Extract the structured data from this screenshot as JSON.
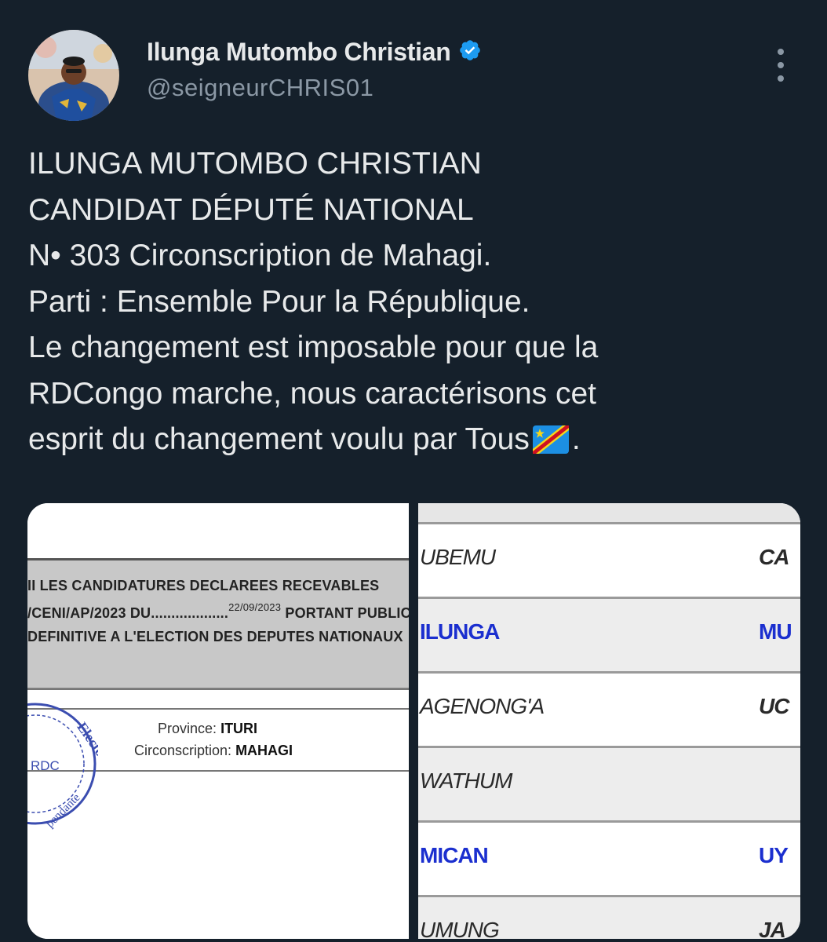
{
  "tweet": {
    "author_name": "Ilunga Mutombo Christian",
    "author_handle": "@seigneurCHRIS01",
    "verified_icon": "verified-badge-icon",
    "lines": [
      "ILUNGA MUTOMBO CHRISTIAN",
      "CANDIDAT DÉPUTÉ NATIONAL",
      "N• 303 Circonscription de Mahagi.",
      "Parti : Ensemble Pour la République.",
      "Le changement est imposable pour que la",
      "RDCongo marche, nous caractérisons cet",
      "esprit du changement voulu par Tous",
      "."
    ],
    "colors": {
      "background": "#15202b",
      "text": "#e7e9ea",
      "muted": "#8b98a5",
      "verified": "#1d9bf0"
    }
  },
  "media": {
    "left": {
      "line1": "II LES CANDIDATURES DECLAREES RECEVABLES",
      "line2a": "/CENI/AP/2023 DU...................",
      "date": "22/09/2023",
      "line2b": " PORTANT PUBLICATION",
      "line3": "DEFINITIVE A L'ELECTION DES DEPUTES NATIONAUX",
      "province_label": "Province:",
      "province_value": "ITURI",
      "circ_label": "Circonscription:",
      "circ_value": "MAHAGI",
      "stamp_top": "Electorale",
      "stamp_left": "RDC",
      "stamp_bottom": "pendante"
    },
    "right": {
      "rows": [
        {
          "left": "UBEMU",
          "right": "CA"
        },
        {
          "left": "ILUNGA",
          "right": "MU"
        },
        {
          "left": "AGENONG'A",
          "right": "UC"
        },
        {
          "left": "WATHUM",
          "right": ""
        },
        {
          "left": "MICAN",
          "right": "UY"
        },
        {
          "left": "UMUNG",
          "right": "JA"
        }
      ],
      "highlight_color": "#1b2fcf"
    }
  }
}
